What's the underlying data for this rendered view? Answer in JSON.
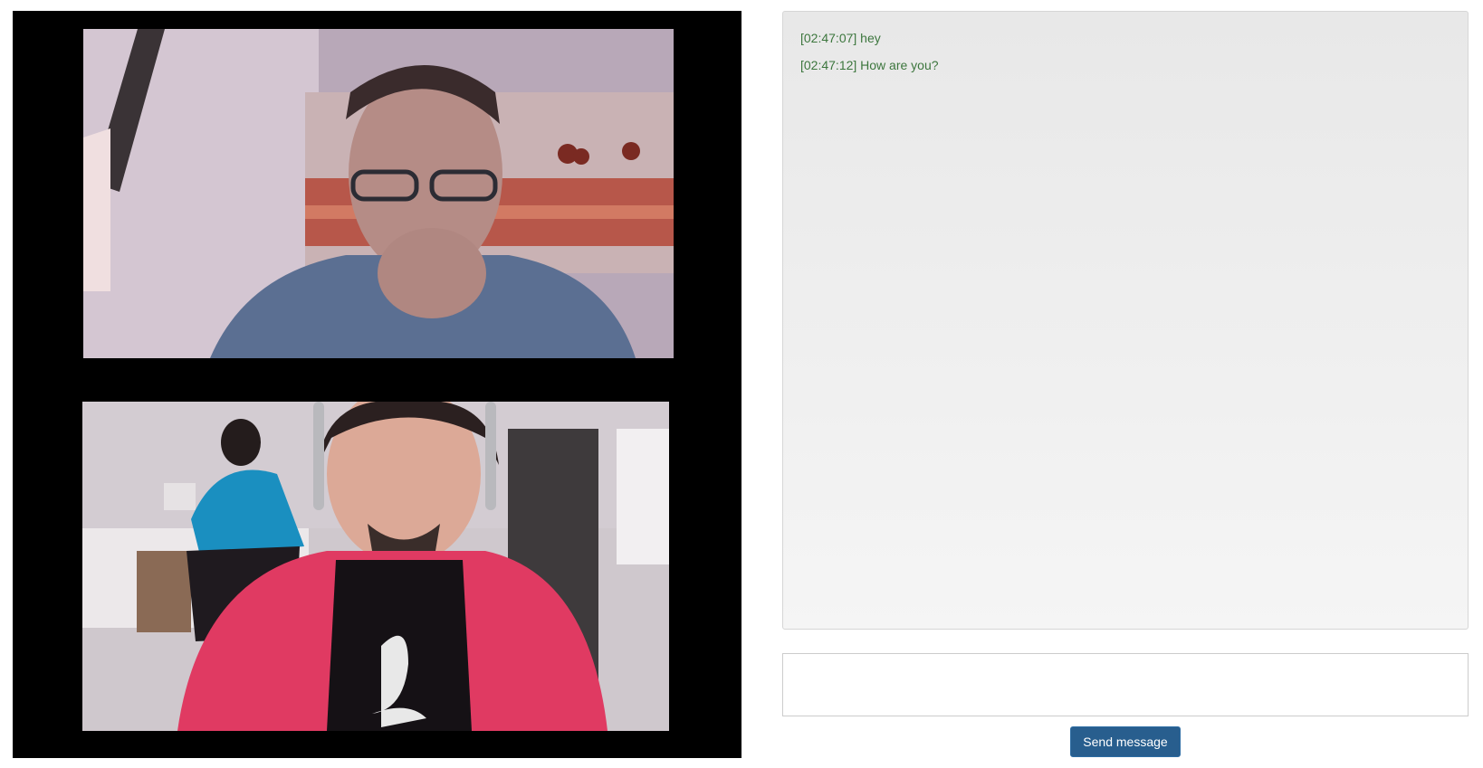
{
  "video": {
    "remote_feed": "remote-participant-video",
    "local_feed": "local-participant-video"
  },
  "chat": {
    "messages": [
      {
        "time": "[02:47:07]",
        "text": "hey",
        "display": "[02:47:07] hey"
      },
      {
        "time": "[02:47:12]",
        "text": "How are you?",
        "display": "[02:47:12] How are you?"
      }
    ],
    "input_value": "",
    "send_label": "Send message"
  },
  "colors": {
    "video_background": "#000000",
    "message_text": "#3c763d",
    "send_button": "#285e8e"
  }
}
